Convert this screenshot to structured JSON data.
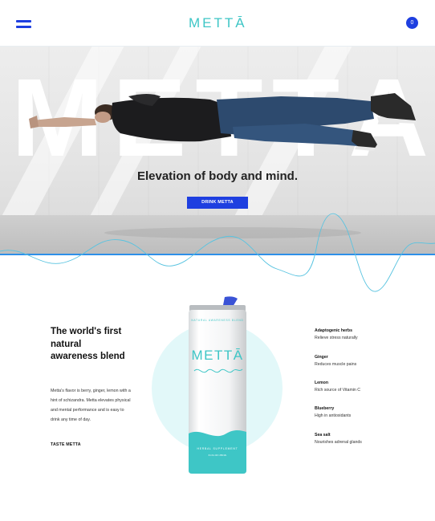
{
  "header": {
    "logo_text": "METTĀ",
    "cart_count": "0",
    "icons": {
      "menu": "hamburger-menu-icon"
    },
    "accent_color": "#1e3fe0",
    "brand_color": "#3ec6c6"
  },
  "hero": {
    "background_word": [
      "M",
      "E",
      "T",
      "T",
      "A"
    ],
    "title": "Elevation of body and mind.",
    "cta_label": "DRINK METTA"
  },
  "intro": {
    "title": "The world's first natural awareness blend",
    "body": "Metta's flavor is berry, ginger, lemon with a hint of schizandra. Metta elevates physical and mental performance and is easy to drink any time of day.",
    "link_label": "TASTE METTA"
  },
  "can": {
    "brand": "METTĀ",
    "top_text": "NATURAL AWARENESS BLEND",
    "bottom_text": "HERBAL SUPPLEMENT",
    "volume_text": "8.4 FL OZ / 250 ML"
  },
  "ingredients": [
    {
      "name": "Adaptogenic herbs",
      "desc": "Relieve stress naturally"
    },
    {
      "name": "Ginger",
      "desc": "Reduces muscle pains"
    },
    {
      "name": "Lemon",
      "desc": "Rich source of Vitamin C"
    },
    {
      "name": "Blueberry",
      "desc": "High in antioxidants"
    },
    {
      "name": "Sea salt",
      "desc": "Nourishes adrenal glands"
    }
  ]
}
